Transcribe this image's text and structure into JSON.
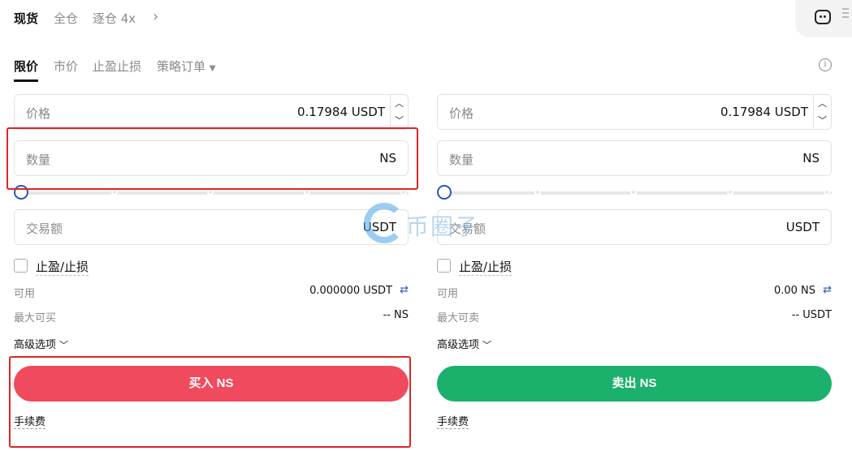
{
  "top_tabs": [
    "现货",
    "全仓",
    "逐仓 4x"
  ],
  "order_tabs": [
    "限价",
    "市价",
    "止盈止损",
    "策略订单"
  ],
  "buy": {
    "price_label": "价格",
    "price_value": "0.17984 USDT",
    "quantity_label": "数量",
    "quantity_unit": "NS",
    "amount_label": "交易额",
    "amount_unit": "USDT",
    "tpsl_label": "止盈/止损",
    "available_label": "可用",
    "available_value": "0.000000 USDT",
    "max_label": "最大可买",
    "max_value": "-- NS",
    "advanced_label": "高级选项",
    "button_label": "买入 NS",
    "fee_label": "手续费"
  },
  "sell": {
    "price_label": "价格",
    "price_value": "0.17984 USDT",
    "quantity_label": "数量",
    "quantity_unit": "NS",
    "amount_label": "交易额",
    "amount_unit": "USDT",
    "tpsl_label": "止盈/止损",
    "available_label": "可用",
    "available_value": "0.00 NS",
    "max_label": "最大可卖",
    "max_value": "-- USDT",
    "advanced_label": "高级选项",
    "button_label": "卖出 NS",
    "fee_label": "手续费"
  },
  "watermark_text": "币圈子",
  "colors": {
    "buy": "#f04a5f",
    "sell": "#1bb06b",
    "slider": "#2a56b8",
    "highlight_box": "#e02424"
  },
  "icons": [
    "chevron-right-icon",
    "robot-icon",
    "menu-icon",
    "caret-down-icon",
    "info-icon",
    "stepper-up-icon",
    "stepper-down-icon",
    "swap-icon",
    "chevron-down-icon"
  ]
}
